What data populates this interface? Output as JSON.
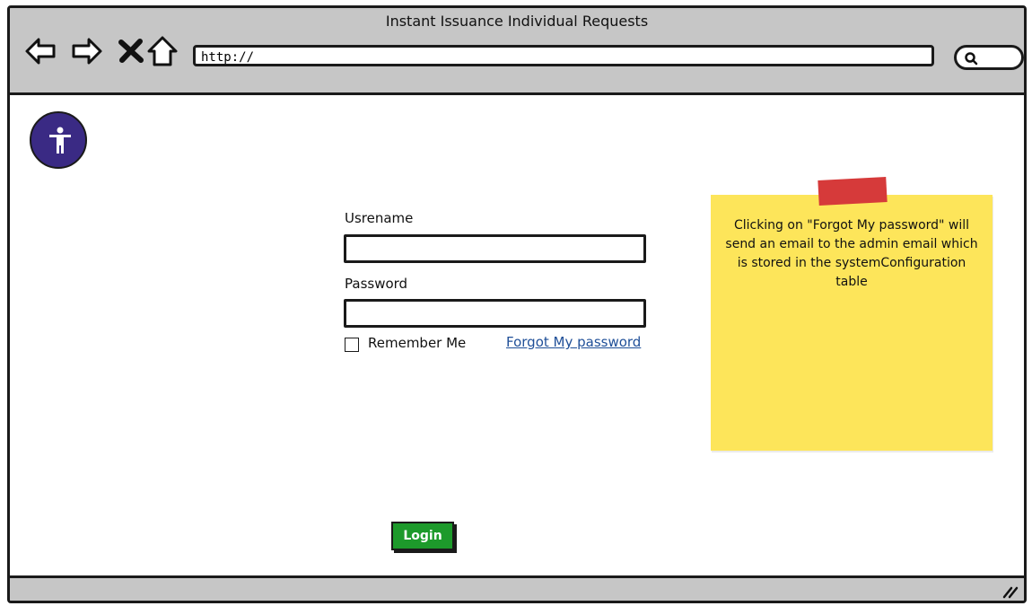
{
  "window": {
    "title": "Instant Issuance Individual Requests"
  },
  "browser": {
    "address_value": "http://",
    "nav": {
      "back": "back-arrow-icon",
      "forward": "forward-arrow-icon",
      "stop": "close-icon",
      "home": "home-icon"
    },
    "search_icon": "search-icon"
  },
  "form": {
    "username_label": "Usrename",
    "password_label": "Password",
    "username_value": "",
    "password_value": "",
    "remember_label": "Remember Me",
    "remember_checked": false,
    "forgot_label": "Forgot My password",
    "login_label": "Login"
  },
  "note": {
    "text": "Clicking on  \"Forgot My password\" will send an email to the admin email which is stored in the systemConfiguration table"
  },
  "colors": {
    "chrome": "#c6c6c6",
    "avatar_bg": "#3a2a84",
    "link": "#1f4f98",
    "login_bg": "#1d9a2b",
    "note_bg": "#fde55a",
    "tape": "#d63a3a"
  }
}
